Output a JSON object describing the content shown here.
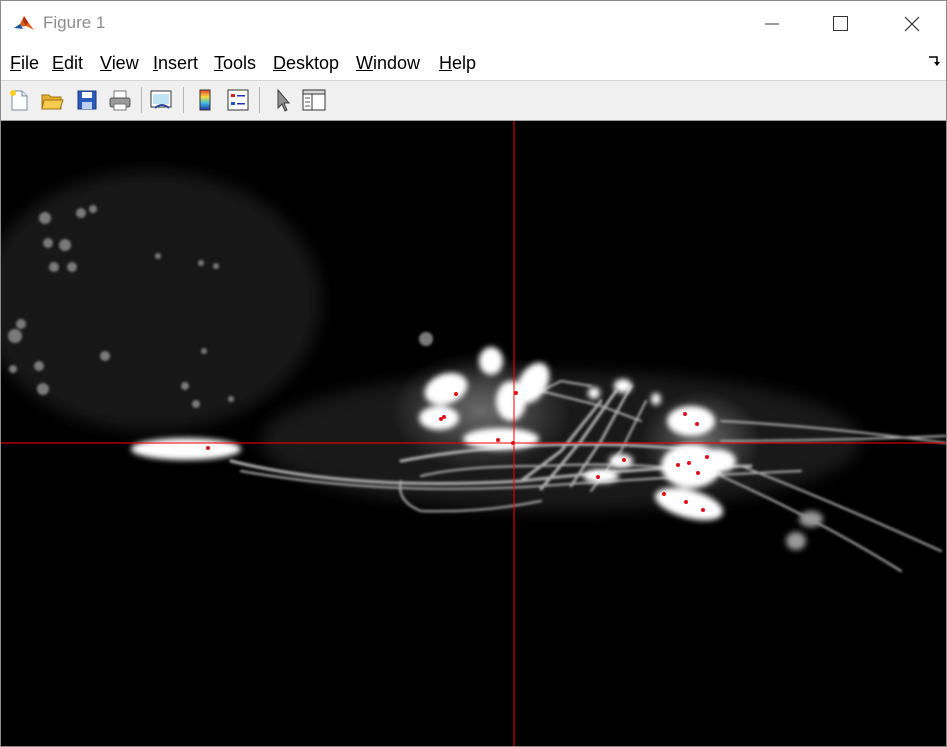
{
  "window": {
    "title": "Figure 1"
  },
  "menu": {
    "file": "File",
    "edit": "Edit",
    "view": "View",
    "insert": "Insert",
    "tools": "Tools",
    "desktop": "Desktop",
    "window": "Window",
    "help": "Help"
  },
  "toolbar": {
    "buttons": [
      "new-figure-icon",
      "open-file-icon",
      "save-icon",
      "print-icon",
      "link-plot-icon",
      "insert-colorbar-icon",
      "insert-legend-icon",
      "edit-plot-icon",
      "property-inspector-icon"
    ]
  },
  "figure": {
    "crosshair_color": "#ff0000",
    "marker_color": "#e0101a",
    "background": "#000000"
  }
}
